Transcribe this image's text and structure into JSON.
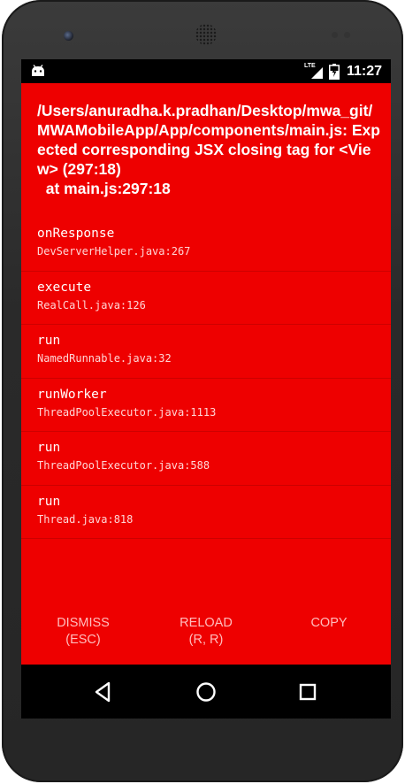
{
  "status_bar": {
    "network": "LTE",
    "time": "11:27"
  },
  "redbox": {
    "title": "/Users/anuradha.k.pradhan/Desktop/mwa_git/MWAMobileApp/App/components/main.js: Expected corresponding JSX closing tag for <View> (297:18)\n  at main.js:297:18",
    "stack": [
      {
        "method": "onResponse",
        "file": "DevServerHelper.java:267"
      },
      {
        "method": "execute",
        "file": "RealCall.java:126"
      },
      {
        "method": "run",
        "file": "NamedRunnable.java:32"
      },
      {
        "method": "runWorker",
        "file": "ThreadPoolExecutor.java:1113"
      },
      {
        "method": "run",
        "file": "ThreadPoolExecutor.java:588"
      },
      {
        "method": "run",
        "file": "Thread.java:818"
      }
    ],
    "buttons": {
      "dismiss": {
        "line1": "DISMISS",
        "line2": "(ESC)"
      },
      "reload": {
        "line1": "RELOAD",
        "line2": "(R, R)"
      },
      "copy": {
        "line1": "COPY",
        "line2": ""
      }
    }
  },
  "icons": {
    "status_left": "android-debug-icon",
    "signal": "signal-icon",
    "battery": "battery-charging-icon",
    "nav_back": "back-triangle-icon",
    "nav_home": "home-circle-icon",
    "nav_recents": "recents-square-icon"
  },
  "colors": {
    "redbox_background": "#ee0000",
    "button_text": "#ffbdbd"
  }
}
